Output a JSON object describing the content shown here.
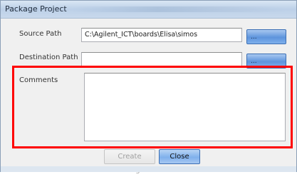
{
  "window": {
    "title": "Package Project"
  },
  "form": {
    "source_label": "Source Path",
    "source_value": "C:\\Agilent_ICT\\boards\\Elisa\\simos",
    "destination_label": "Destination Path",
    "destination_value": "",
    "comments_label": "Comments",
    "comments_value": "",
    "browse_label": "..."
  },
  "buttons": {
    "create_package": "Create Package",
    "close": "Close"
  },
  "colors": {
    "highlight": "#ff0000",
    "accent": "#5d94dc"
  }
}
